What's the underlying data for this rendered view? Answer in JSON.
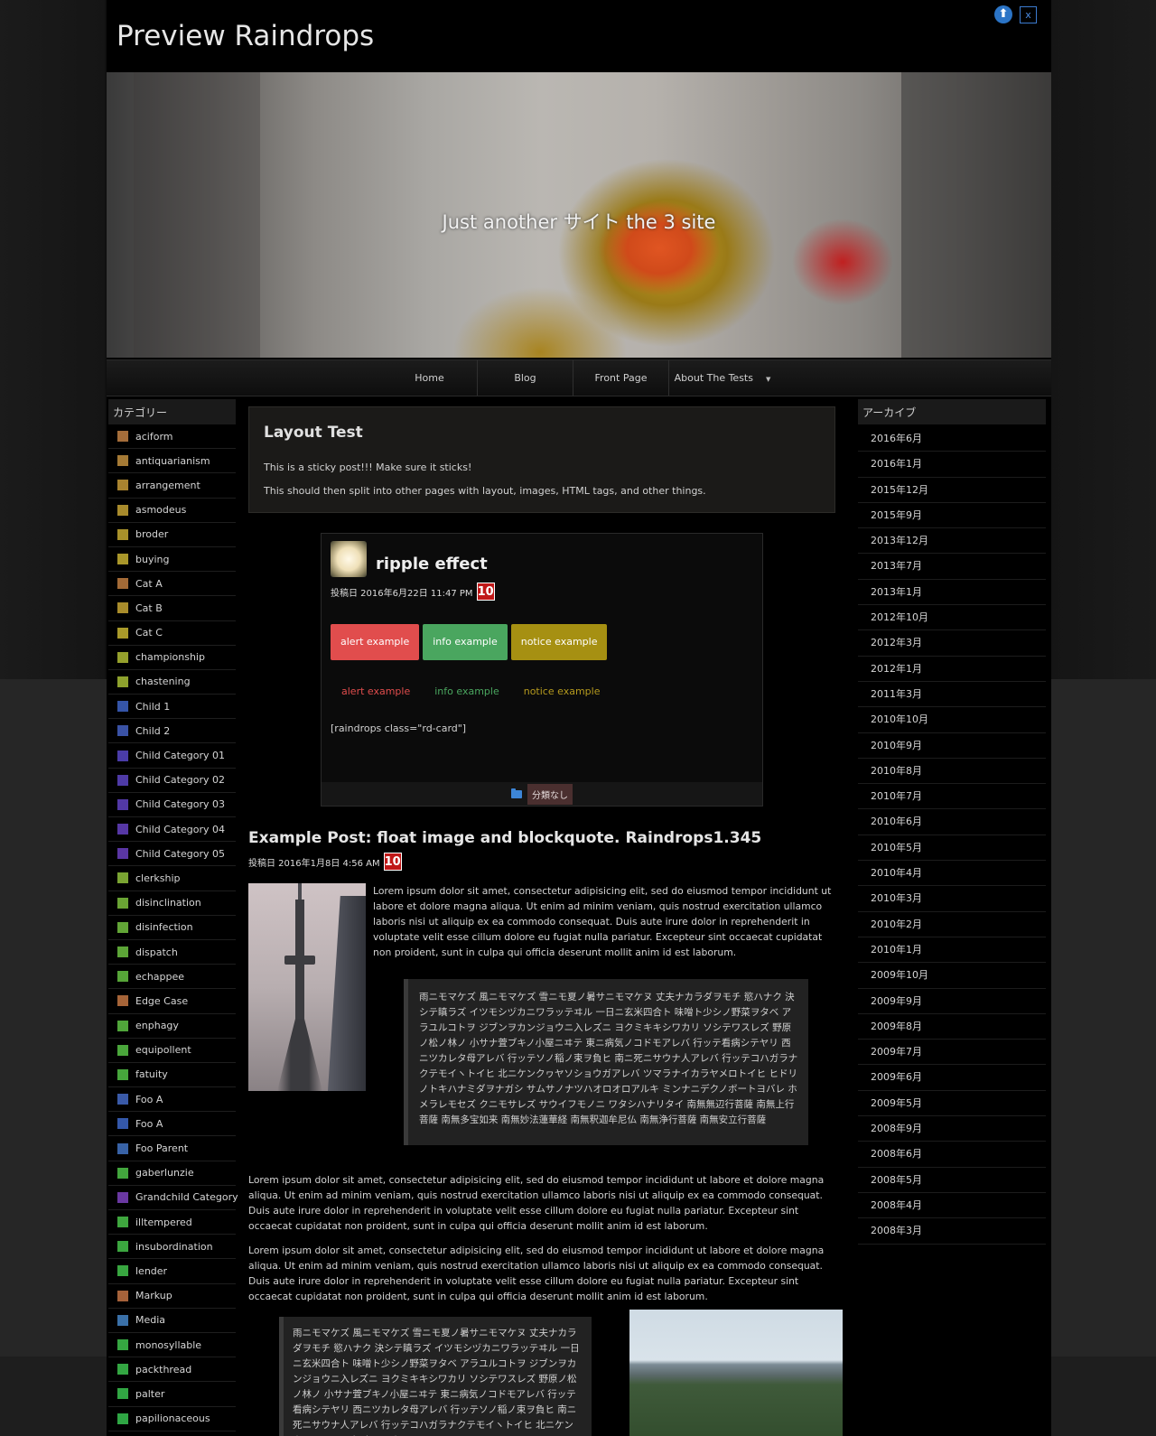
{
  "site": {
    "title": "Preview Raindrops",
    "tagline": "Just another サイト the 3 site"
  },
  "nav": {
    "items": [
      "Home",
      "Blog",
      "Front Page",
      "About The Tests"
    ],
    "caret": "▼"
  },
  "left_sidebar": {
    "title": "カテゴリー",
    "categories": [
      {
        "label": "aciform",
        "color": "#a56d3a"
      },
      {
        "label": "antiquarianism",
        "color": "#a57a35"
      },
      {
        "label": "arrangement",
        "color": "#a8832f"
      },
      {
        "label": "asmodeus",
        "color": "#a88b2c"
      },
      {
        "label": "broder",
        "color": "#a8912a"
      },
      {
        "label": "buying",
        "color": "#a9962a"
      },
      {
        "label": "Cat A",
        "color": "#a36a36"
      },
      {
        "label": "Cat B",
        "color": "#a98c2b"
      },
      {
        "label": "Cat C",
        "color": "#a99a2a"
      },
      {
        "label": "championship",
        "color": "#95a02c"
      },
      {
        "label": "chastening",
        "color": "#8ea22d"
      },
      {
        "label": "Child 1",
        "color": "#3555a8"
      },
      {
        "label": "Child 2",
        "color": "#3a52a5"
      },
      {
        "label": "Child Category 01",
        "color": "#4a3ca8"
      },
      {
        "label": "Child Category 02",
        "color": "#4e3aa6"
      },
      {
        "label": "Child Category 03",
        "color": "#5238a6"
      },
      {
        "label": "Child Category 04",
        "color": "#5637a5"
      },
      {
        "label": "Child Category 05",
        "color": "#5a36a4"
      },
      {
        "label": "clerkship",
        "color": "#7aa432"
      },
      {
        "label": "disinclination",
        "color": "#6aa434"
      },
      {
        "label": "disinfection",
        "color": "#62a536"
      },
      {
        "label": "dispatch",
        "color": "#5ca537"
      },
      {
        "label": "echappee",
        "color": "#56a538"
      },
      {
        "label": "Edge Case",
        "color": "#a66438"
      },
      {
        "label": "enphagy",
        "color": "#50a63a"
      },
      {
        "label": "equipollent",
        "color": "#4aa63b"
      },
      {
        "label": "fatuity",
        "color": "#46a63c"
      },
      {
        "label": "Foo A",
        "color": "#3a5aa8"
      },
      {
        "label": "Foo A",
        "color": "#3458aa"
      },
      {
        "label": "Foo Parent",
        "color": "#3862a6"
      },
      {
        "label": "gaberlunzie",
        "color": "#42a63d"
      },
      {
        "label": "Grandchild Category",
        "color": "#6a38a2"
      },
      {
        "label": "illtempered",
        "color": "#3ea63e"
      },
      {
        "label": "insubordination",
        "color": "#3ba63f"
      },
      {
        "label": "lender",
        "color": "#38a640"
      },
      {
        "label": "Markup",
        "color": "#a6623a"
      },
      {
        "label": "Media",
        "color": "#3a70a8"
      },
      {
        "label": "monosyllable",
        "color": "#35a641"
      },
      {
        "label": "packthread",
        "color": "#33a642"
      },
      {
        "label": "palter",
        "color": "#31a643"
      },
      {
        "label": "papilionaceous",
        "color": "#2fa644"
      }
    ]
  },
  "right_sidebar": {
    "title": "アーカイブ",
    "archives": [
      "2016年6月",
      "2016年1月",
      "2015年12月",
      "2015年9月",
      "2013年12月",
      "2013年7月",
      "2013年1月",
      "2012年10月",
      "2012年3月",
      "2012年1月",
      "2011年3月",
      "2010年10月",
      "2010年9月",
      "2010年8月",
      "2010年7月",
      "2010年6月",
      "2010年5月",
      "2010年4月",
      "2010年3月",
      "2010年2月",
      "2010年1月",
      "2009年10月",
      "2009年9月",
      "2009年8月",
      "2009年7月",
      "2009年6月",
      "2009年5月",
      "2008年9月",
      "2008年6月",
      "2008年5月",
      "2008年4月",
      "2008年3月"
    ]
  },
  "sticky": {
    "title": "Layout Test",
    "p1": "This is a sticky post!!! Make sure it sticks!",
    "p2": "This should then split into other pages with layout, images, HTML tags, and other things."
  },
  "ripple": {
    "title": "ripple effect",
    "meta": "投稿日 2016年6月22日 11:47 PM",
    "day": "10",
    "btn_alert": "alert example",
    "btn_info": "info example",
    "btn_notice": "notice example",
    "txt_alert": "alert example",
    "txt_info": "info example",
    "txt_notice": "notice example",
    "shortcode": "[raindrops class=\"rd-card\"]",
    "category": "分類なし"
  },
  "post2": {
    "title": "Example Post: float image and blockquote. Raindrops1.345",
    "meta": "投稿日 2016年1月8日 4:56 AM",
    "day": "10",
    "lorem": "Lorem ipsum dolor sit amet, consectetur adipisicing elit, sed do eiusmod tempor incididunt ut labore et dolore magna aliqua. Ut enim ad minim veniam, quis nostrud exercitation ullamco laboris nisi ut aliquip ex ea commodo consequat. Duis aute irure dolor in reprehenderit in voluptate velit esse cillum dolore eu fugiat nulla pariatur. Excepteur sint occaecat cupidatat non proident, sunt in culpa qui officia deserunt mollit anim id est laborum.",
    "blockquote": "雨ニモマケズ 風ニモマケズ 雪ニモ夏ノ暑サニモマケヌ 丈夫ナカラダヲモチ 慾ハナク 決シテ瞋ラズ イツモシヅカニワラッテヰル 一日ニ玄米四合ト 味噌ト少シノ野菜ヲタベ アラユルコトヲ ジブンヲカンジョウニ入レズニ ヨクミキキシワカリ ソシテワスレズ 野原ノ松ノ林ノ 小サナ萓ブキノ小屋ニヰテ 東ニ病気ノコドモアレバ 行ッテ看病シテヤリ 西ニツカレタ母アレバ 行ッテソノ稲ノ束ヲ負ヒ 南ニ死ニサウナ人アレバ 行ッテコハガラナクテモイヽトイヒ 北ニケンクヮヤソショウガアレバ ツマラナイカラヤメロトイヒ ヒドリノトキハナミダヲナガシ サムサノナツハオロオロアルキ ミンナニデクノボートヨバレ ホメラレモセズ クニモサレズ サウイフモノニ ワタシハナリタイ 南無無辺行菩薩 南無上行菩薩 南無多宝如来 南無妙法蓮華経 南無釈迦牟尼仏 南無浄行菩薩 南無安立行菩薩",
    "para1": "Lorem ipsum dolor sit amet, consectetur adipisicing elit, sed do eiusmod tempor incididunt ut labore et dolore magna aliqua. Ut enim ad minim veniam, quis nostrud exercitation ullamco laboris nisi ut aliquip ex ea commodo consequat. Duis aute irure dolor in reprehenderit in voluptate velit esse cillum dolore eu fugiat nulla pariatur. Excepteur sint occaecat cupidatat non proident, sunt in culpa qui officia deserunt mollit anim id est laborum.",
    "para2": "Lorem ipsum dolor sit amet, consectetur adipisicing elit, sed do eiusmod tempor incididunt ut labore et dolore magna aliqua. Ut enim ad minim veniam, quis nostrud exercitation ullamco laboris nisi ut aliquip ex ea commodo consequat. Duis aute irure dolor in reprehenderit in voluptate velit esse cillum dolore eu fugiat nulla pariatur. Excepteur sint occaecat cupidatat non proident, sunt in culpa qui officia deserunt mollit anim id est laborum.",
    "blockquote2": "雨ニモマケズ 風ニモマケズ 雪ニモ夏ノ暑サニモマケヌ 丈夫ナカラダヲモチ 慾ハナク 決シテ瞋ラズ イツモシヅカニワラッテヰル 一日ニ玄米四合ト 味噌ト少シノ野菜ヲタベ アラユルコトヲ ジブンヲカンジョウニ入レズニ ヨクミキキシワカリ ソシテワスレズ 野原ノ松ノ林ノ 小サナ萓ブキノ小屋ニヰテ 東ニ病気ノコドモアレバ 行ッテ看病シテヤリ 西ニツカレタ母アレバ 行ッテソノ稲ノ束ヲ負ヒ 南ニ死ニサウナ人アレバ 行ッテコハガラナクテモイヽトイヒ 北ニケンクヮヤソショウガアレバ"
  },
  "icons": {
    "up": "⬆",
    "close": "x"
  }
}
